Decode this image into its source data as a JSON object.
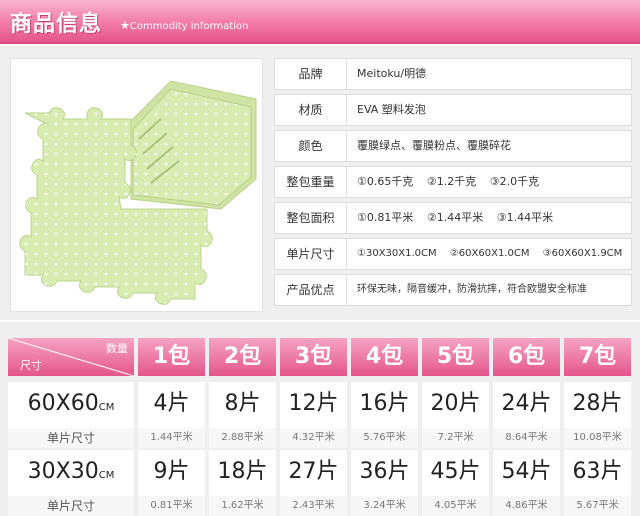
{
  "header": {
    "title": "商品信息",
    "star": "★",
    "subtitle": "Commodity information"
  },
  "specs": [
    {
      "label": "品牌",
      "values": [
        "Meitoku/明德"
      ]
    },
    {
      "label": "材质",
      "values": [
        "EVA 塑料发泡"
      ]
    },
    {
      "label": "颜色",
      "values": [
        "覆膜绿点、覆膜粉点、覆膜碎花"
      ]
    },
    {
      "label": "整包重量",
      "values": [
        "①0.65千克",
        "②1.2千克",
        "③2.0千克"
      ]
    },
    {
      "label": "整包面积",
      "values": [
        "①0.81平米",
        "②1.44平米",
        "③1.44平米"
      ]
    },
    {
      "label": "单片尺寸",
      "values": [
        "①30X30X1.0CM",
        "②60X60X1.0CM",
        "③60X60X1.9CM"
      ]
    },
    {
      "label": "产品优点",
      "values": [
        "环保无味，隔音缓冲，防滑抗摔，符合欧盟安全标准"
      ]
    }
  ],
  "qty_table": {
    "corner_qty": "数量",
    "corner_size": "尺寸",
    "packs": [
      "1包",
      "2包",
      "3包",
      "4包",
      "5包",
      "6包",
      "7包"
    ],
    "rows": [
      {
        "size": "60X60",
        "unit": "CM",
        "sub_label": "单片尺寸",
        "counts": [
          "4片",
          "8片",
          "12片",
          "16片",
          "20片",
          "24片",
          "28片"
        ],
        "areas": [
          "1.44平米",
          "2.88平米",
          "4.32平米",
          "5.76平米",
          "7.2平米",
          "8.64平米",
          "10.08平米"
        ]
      },
      {
        "size": "30X30",
        "unit": "CM",
        "sub_label": "单片尺寸",
        "counts": [
          "9片",
          "18片",
          "27片",
          "36片",
          "45片",
          "54片",
          "63片"
        ],
        "areas": [
          "0.81平米",
          "1.62平米",
          "2.43平米",
          "3.24平米",
          "4.05平米",
          "4.86平米",
          "5.67平米"
        ]
      }
    ]
  },
  "colors": {
    "accent_pink": "#e4568a",
    "mat_green": "#d8ebb0",
    "dot_white": "#ffffff"
  }
}
